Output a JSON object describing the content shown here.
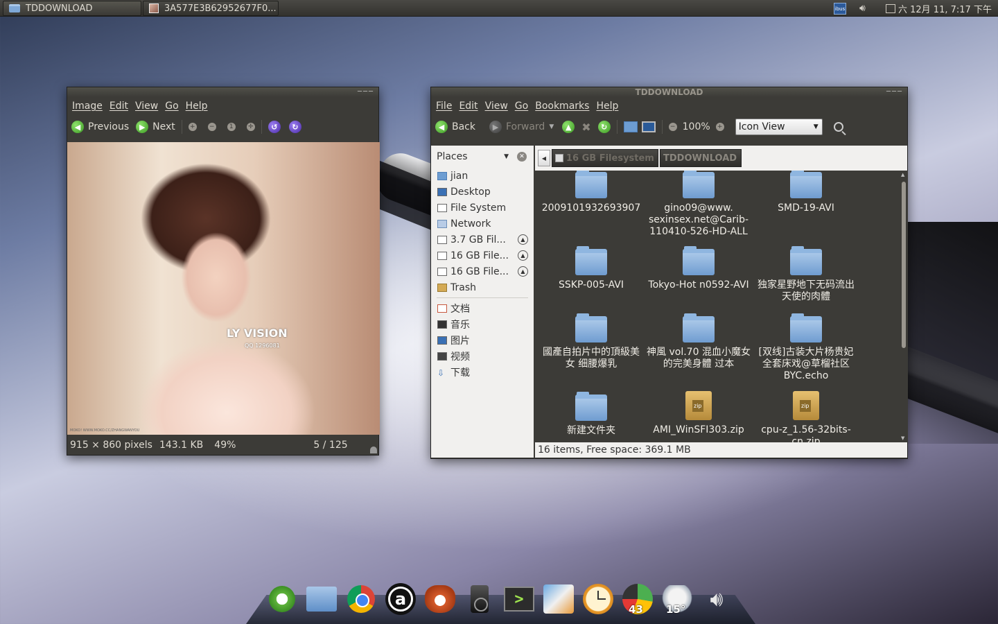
{
  "top_panel": {
    "tasks": [
      {
        "label": "TDDOWNLOAD"
      },
      {
        "label": "3A577E3B62952677F0..."
      }
    ],
    "ibus_label": "ibus",
    "clock": "六 12月 11,  7:17 下午"
  },
  "image_viewer": {
    "menu": [
      "Image",
      "Edit",
      "View",
      "Go",
      "Help"
    ],
    "toolbar": {
      "previous": "Previous",
      "next": "Next"
    },
    "watermark": {
      "title": "LY VISION",
      "qq": "QQ 1296081",
      "url": "MOKO! WWW.MOKO.CC/ZHANGWANYOU"
    },
    "status": {
      "dimensions": "915 × 860 pixels",
      "size": "143.1 KB",
      "zoom": "49%",
      "position": "5 / 125"
    }
  },
  "file_manager": {
    "title": "TDDOWNLOAD",
    "menu": [
      "File",
      "Edit",
      "View",
      "Go",
      "Bookmarks",
      "Help"
    ],
    "toolbar": {
      "back": "Back",
      "forward": "Forward",
      "zoom": "100%",
      "view_mode": "Icon View"
    },
    "sidebar": {
      "heading": "Places",
      "places": [
        {
          "label": "jian",
          "icon": "home-folder-icon"
        },
        {
          "label": "Desktop",
          "icon": "desktop-icon"
        },
        {
          "label": "File System",
          "icon": "drive-icon"
        },
        {
          "label": "Network",
          "icon": "network-icon"
        },
        {
          "label": "3.7 GB Fil...",
          "icon": "drive-icon",
          "eject": true
        },
        {
          "label": "16 GB File...",
          "icon": "drive-icon",
          "eject": true
        },
        {
          "label": "16 GB File...",
          "icon": "drive-icon",
          "eject": true
        },
        {
          "label": "Trash",
          "icon": "trash-icon"
        }
      ],
      "bookmarks": [
        {
          "label": "文档",
          "icon": "documents-folder-icon"
        },
        {
          "label": "音乐",
          "icon": "music-folder-icon"
        },
        {
          "label": "图片",
          "icon": "pictures-folder-icon"
        },
        {
          "label": "视频",
          "icon": "videos-folder-icon"
        },
        {
          "label": "下载",
          "icon": "downloads-folder-icon"
        }
      ]
    },
    "pathbar": [
      {
        "label": "16 GB Filesystem"
      },
      {
        "label": "TDDOWNLOAD"
      }
    ],
    "items": [
      {
        "name": "2009101932693907",
        "type": "folder"
      },
      {
        "name": "gino09@www. sexinsex.net@Carib-110410-526-HD-ALL",
        "type": "folder"
      },
      {
        "name": "SMD-19-AVI",
        "type": "folder"
      },
      {
        "name": "SSKP-005-AVI",
        "type": "folder"
      },
      {
        "name": "Tokyo-Hot n0592-AVI",
        "type": "folder"
      },
      {
        "name": "独家星野地下无码流出天使的肉體",
        "type": "folder"
      },
      {
        "name": "國產自拍片中的頂級美女 细腰爆乳",
        "type": "folder"
      },
      {
        "name": "神風 vol.70 混血小魔女的完美身體 过本",
        "type": "folder"
      },
      {
        "name": "[双线]古装大片杨贵妃全套床戏@草榴社区BYC.echo",
        "type": "folder"
      },
      {
        "name": "新建文件夹",
        "type": "folder"
      },
      {
        "name": "AMI_WinSFI303.zip",
        "type": "zip"
      },
      {
        "name": "cpu-z_1.56-32bits-cn.zip",
        "type": "zip"
      }
    ],
    "status": "16 items, Free space: 369.1 MB"
  },
  "dock": {
    "items": [
      {
        "name": "ubuntu-one-icon"
      },
      {
        "name": "home-folder-icon"
      },
      {
        "name": "chrome-icon"
      },
      {
        "name": "amazon-icon"
      },
      {
        "name": "firefox-icon"
      },
      {
        "name": "speaker-icon"
      },
      {
        "name": "terminal-icon"
      },
      {
        "name": "paint-icon"
      },
      {
        "name": "clock-icon"
      },
      {
        "name": "system-monitor-icon",
        "badge": "43"
      },
      {
        "name": "weather-icon",
        "badge": "15°"
      },
      {
        "name": "volume-icon"
      }
    ]
  }
}
